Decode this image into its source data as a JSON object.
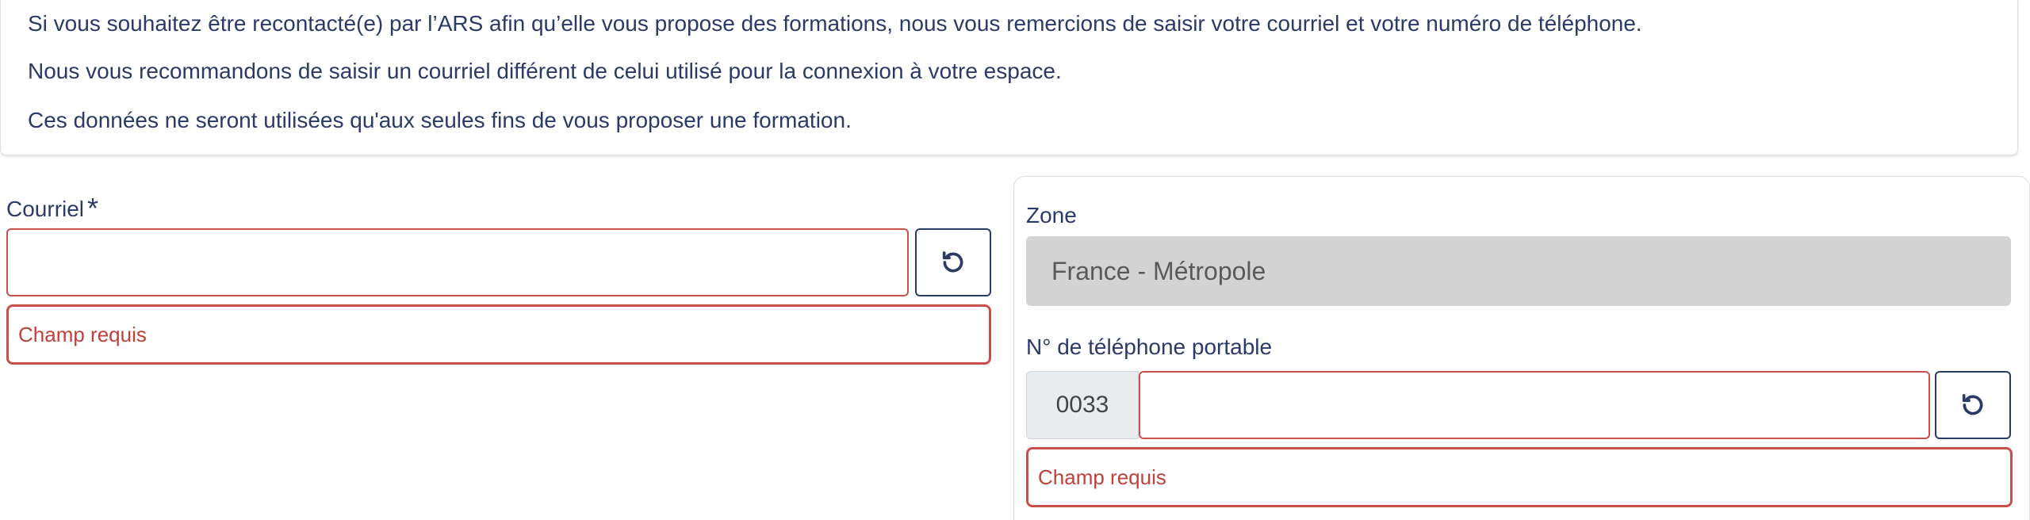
{
  "info": {
    "line1": "Si vous souhaitez être recontacté(e) par l’ARS afin qu’elle vous propose des formations, nous vous remercions de saisir votre courriel et votre numéro de téléphone.",
    "line2": "Nous vous recommandons de saisir un courriel différent de celui utilisé pour la connexion à votre espace.",
    "line3": "Ces données ne seront utilisées qu'aux seules fins de vous proposer une formation."
  },
  "email": {
    "label": "Courriel",
    "required_mark": "*",
    "value": "",
    "reset_icon": "reset-icon",
    "error": "Champ requis"
  },
  "zone": {
    "label": "Zone",
    "value": "France - Métropole"
  },
  "phone": {
    "label": "N° de téléphone portable",
    "prefix": "0033",
    "value": "",
    "reset_icon": "reset-icon",
    "error": "Champ requis"
  },
  "colors": {
    "text": "#2b3a67",
    "error": "#c7504b",
    "disabled_bg": "#d3d3d3"
  }
}
